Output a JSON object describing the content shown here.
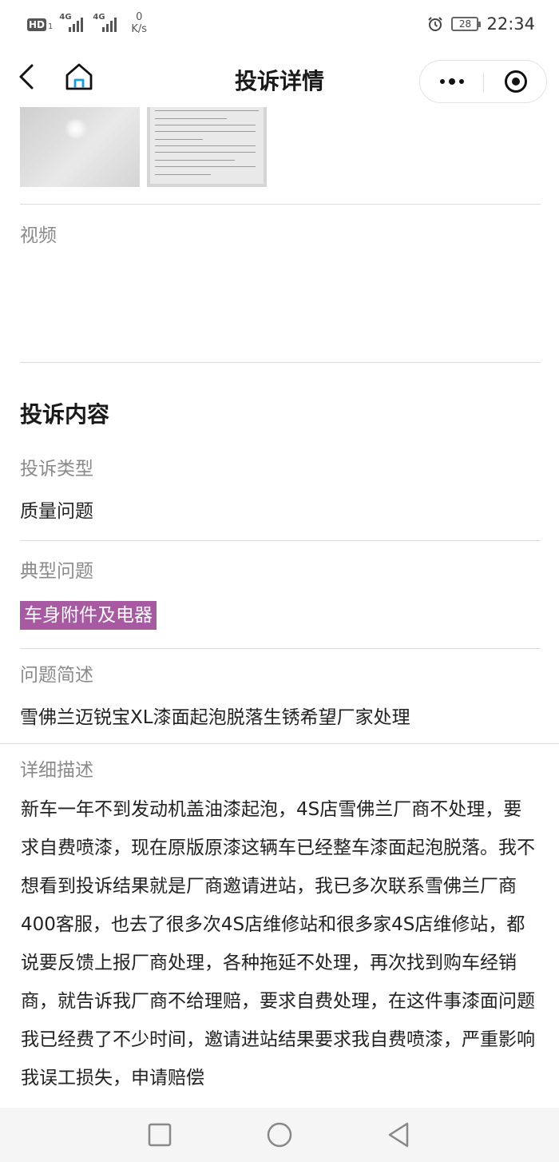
{
  "status_bar": {
    "hd": "HD",
    "sim": "1",
    "net1": "4G",
    "net2": "4G",
    "speed_value": "0",
    "speed_unit": "K/s",
    "battery": "28",
    "time": "22:34"
  },
  "nav": {
    "title": "投诉详情"
  },
  "attachments": {
    "video_label": "视频"
  },
  "complaint": {
    "section_title": "投诉内容",
    "type_label": "投诉类型",
    "type_value": "质量问题",
    "typical_label": "典型问题",
    "typical_tag": "车身附件及电器",
    "summary_label": "问题简述",
    "summary_value": "雪佛兰迈锐宝XL漆面起泡脱落生锈希望厂家处理",
    "detail_label": "详细描述",
    "detail_value": "新车一年不到发动机盖油漆起泡，4S店雪佛兰厂商不处理，要求自费喷漆，现在原版原漆这辆车已经整车漆面起泡脱落。我不想看到投诉结果就是厂商邀请进站，我已多次联系雪佛兰厂商400客服，也去了很多次4S店维修站和很多家4S店维修站，都说要反馈上报厂商处理，各种拖延不处理，再次找到购车经销商，就告诉我厂商不给理赔，要求自费处理，在这件事漆面问题我已经费了不少时间，邀请进站结果要求我自费喷漆，严重影响我误工损失，申请赔偿"
  },
  "colors": {
    "tag_bg": "#a75aa2",
    "label": "#8a8a8a",
    "divider": "#dcdcdc"
  }
}
